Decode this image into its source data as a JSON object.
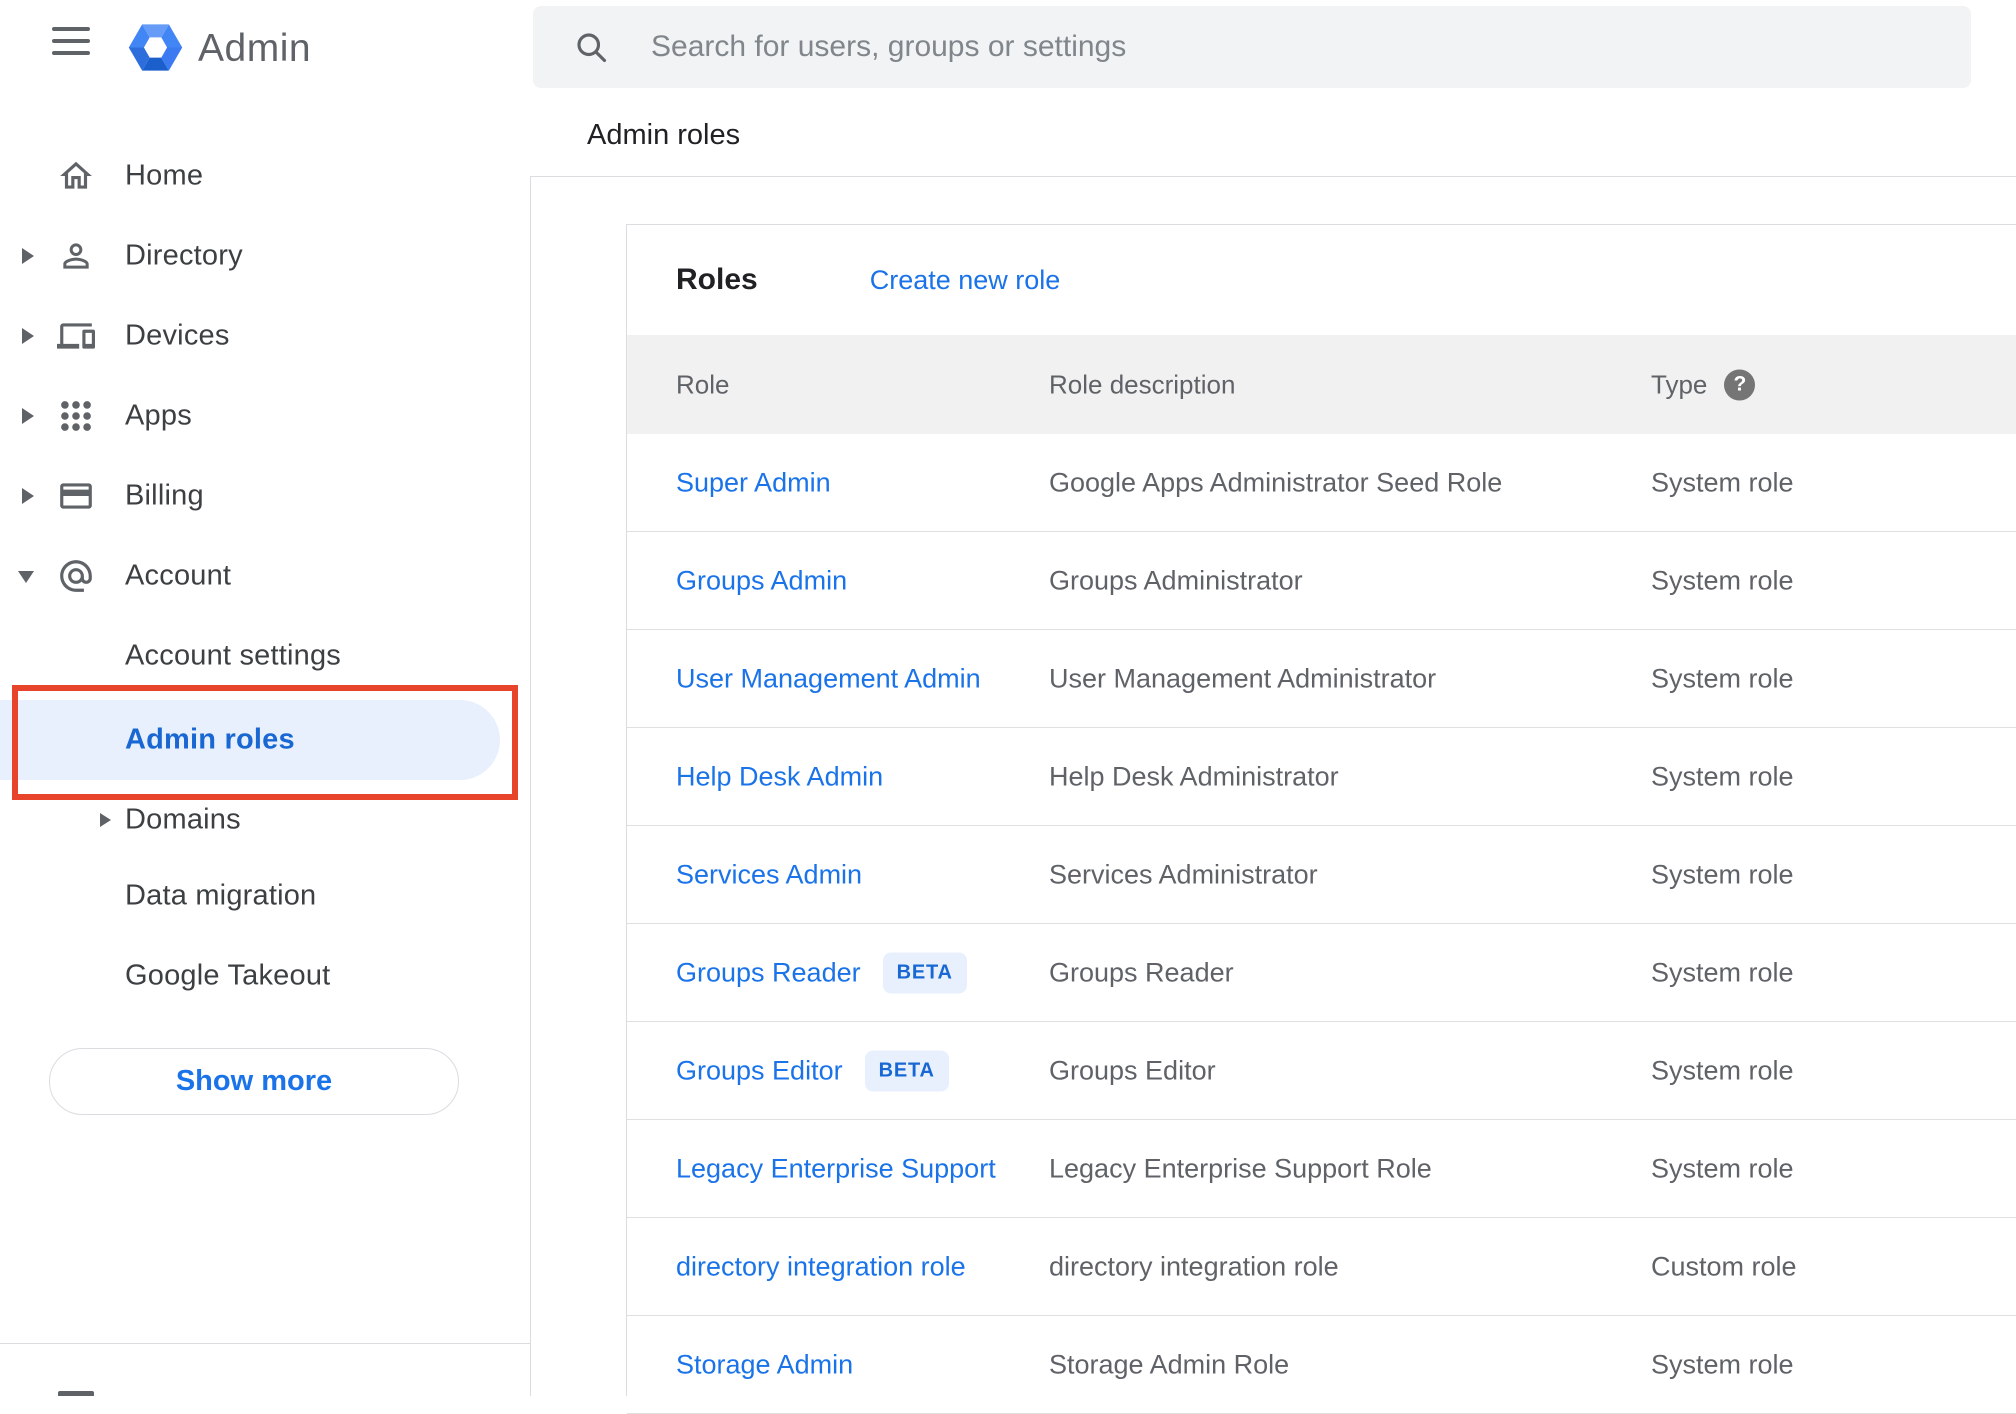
{
  "app": {
    "title": "Admin"
  },
  "header": {
    "search_placeholder": "Search for users, groups or settings",
    "breadcrumb": "Admin roles"
  },
  "sidebar": {
    "items": [
      {
        "label": "Home",
        "icon": "home-icon",
        "expand": "none"
      },
      {
        "label": "Directory",
        "icon": "person-icon",
        "expand": "collapsed"
      },
      {
        "label": "Devices",
        "icon": "devices-icon",
        "expand": "collapsed"
      },
      {
        "label": "Apps",
        "icon": "apps-grid-icon",
        "expand": "collapsed"
      },
      {
        "label": "Billing",
        "icon": "credit-card-icon",
        "expand": "collapsed"
      },
      {
        "label": "Account",
        "icon": "at-email-icon",
        "expand": "expanded"
      }
    ],
    "account_subitems": [
      {
        "label": "Account settings",
        "selected": false
      },
      {
        "label": "Admin roles",
        "selected": true
      },
      {
        "label": "Domains",
        "selected": false,
        "expand": "collapsed"
      },
      {
        "label": "Data migration",
        "selected": false
      },
      {
        "label": "Google Takeout",
        "selected": false
      }
    ],
    "show_more": "Show more"
  },
  "annotation": {
    "shape": "red-highlight-box",
    "around": "Admin roles",
    "color": "#e8432b"
  },
  "main": {
    "section_title": "Roles",
    "create_link": "Create new role",
    "table": {
      "headers": {
        "role": "Role",
        "description": "Role description",
        "type": "Type"
      },
      "help_glyph": "?",
      "rows": [
        {
          "role": "Super Admin",
          "description": "Google Apps Administrator Seed Role",
          "type": "System role"
        },
        {
          "role": "Groups Admin",
          "description": "Groups Administrator",
          "type": "System role"
        },
        {
          "role": "User Management Admin",
          "description": "User Management Administrator",
          "type": "System role"
        },
        {
          "role": "Help Desk Admin",
          "description": "Help Desk Administrator",
          "type": "System role"
        },
        {
          "role": "Services Admin",
          "description": "Services Administrator",
          "type": "System role"
        },
        {
          "role": "Groups Reader",
          "badge": "BETA",
          "description": "Groups Reader",
          "type": "System role"
        },
        {
          "role": "Groups Editor",
          "badge": "BETA",
          "description": "Groups Editor",
          "type": "System role"
        },
        {
          "role": "Legacy Enterprise Support",
          "description": "Legacy Enterprise Support Role",
          "type": "System role"
        },
        {
          "role": "directory integration role",
          "description": "directory integration role",
          "type": "Custom role"
        },
        {
          "role": "Storage Admin",
          "description": "Storage Admin Role",
          "type": "System role"
        }
      ]
    }
  },
  "colors": {
    "accent_blue": "#1a73e8",
    "selected_blue": "#1967d2",
    "selected_bg": "#e8f0fe",
    "annotation_red": "#e8432b",
    "table_header_bg": "#f1f1f1",
    "search_bg": "#f1f3f4"
  }
}
